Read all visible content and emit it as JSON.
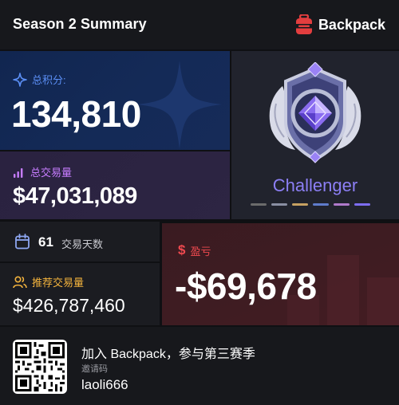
{
  "header": {
    "title": "Season 2 Summary",
    "brand_name": "Backpack",
    "brand_icon": "backpack-icon",
    "brand_color": "#e33e3f"
  },
  "points": {
    "icon": "sparkle-icon",
    "label": "总积分:",
    "value": "134,810",
    "accent": "#5b8ff5"
  },
  "volume": {
    "icon": "bar-chart-icon",
    "label": "总交易量",
    "value": "$47,031,089",
    "accent": "#c77dff"
  },
  "rank": {
    "icon": "challenger-badge-icon",
    "name": "Challenger",
    "tier_colors": [
      "#6b6b6b",
      "#8a8fa3",
      "#c7a162",
      "#5f7ccc",
      "#b07acb",
      "#7d6df2"
    ]
  },
  "trading_days": {
    "icon": "calendar-icon",
    "value": "61",
    "label": "交易天数"
  },
  "referral": {
    "icon": "users-icon",
    "label": "推荐交易量",
    "value": "$426,787,460",
    "accent": "#f3b33d"
  },
  "pnl": {
    "icon": "dollar-icon",
    "label": "盈亏",
    "value": "-$69,678",
    "accent": "#f0494f"
  },
  "invite": {
    "title": "加入 Backpack，参与第三赛季",
    "code_label": "邀请码",
    "code": "laoli666",
    "qr_icon": "qr-code-icon"
  }
}
